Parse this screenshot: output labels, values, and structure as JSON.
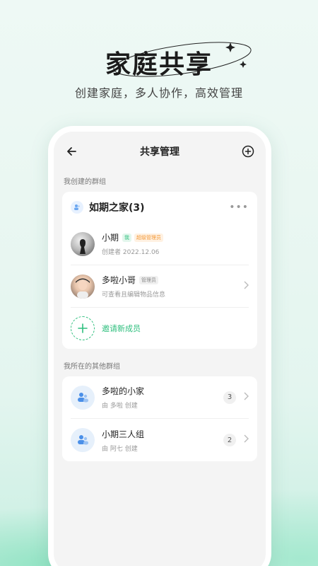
{
  "hero": {
    "title": "家庭共享",
    "subtitle": "创建家庭，多人协作，高效管理"
  },
  "navbar": {
    "title": "共享管理",
    "back_icon": "arrow-left-icon",
    "add_icon": "plus-circle-icon"
  },
  "my_groups": {
    "section_label": "我创建的群组",
    "group_name": "如期之家(3)",
    "members": [
      {
        "name": "小期",
        "tags": [
          "我",
          "超级管理员"
        ],
        "sub": "创建者  2022.12.06"
      },
      {
        "name": "多啦小哥",
        "tags": [
          "管理员"
        ],
        "sub": "可查看且编辑物品信息"
      }
    ],
    "invite_label": "邀请新成员"
  },
  "other_groups": {
    "section_label": "我所在的其他群组",
    "items": [
      {
        "name": "多啦的小家",
        "sub": "由 多啦 创建",
        "count": "3"
      },
      {
        "name": "小期三人组",
        "sub": "由 阿七 创建",
        "count": "2"
      }
    ]
  },
  "colors": {
    "accent": "#2fbf7e",
    "super_admin_tag": "#f39a3a"
  }
}
